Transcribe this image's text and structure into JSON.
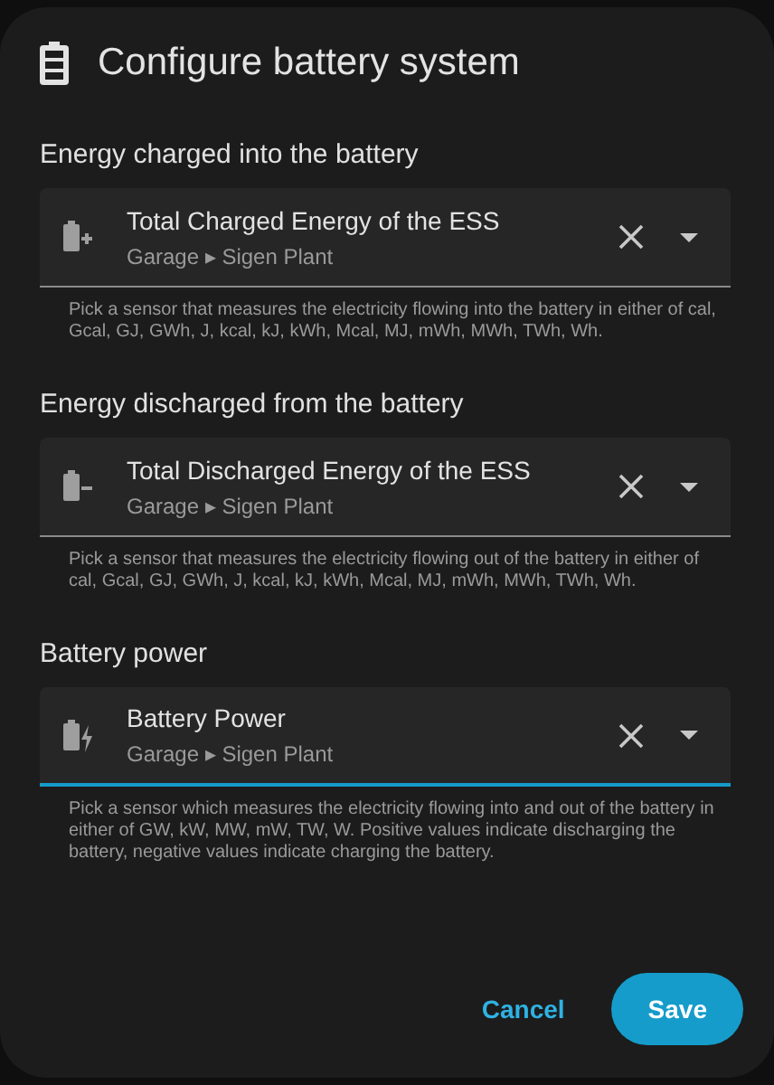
{
  "dialog": {
    "title": "Configure battery system"
  },
  "sections": [
    {
      "label": "Energy charged into the battery",
      "field": {
        "kind": "charging",
        "value": "Total Charged Energy of the ESS",
        "location": "Garage ▸ Sigen Plant",
        "focused": false
      },
      "helper": "Pick a sensor that measures the electricity flowing into the battery in either of cal, Gcal, GJ, GWh, J, kcal, kJ, kWh, Mcal, MJ, mWh, MWh, TWh, Wh."
    },
    {
      "label": "Energy discharged from the battery",
      "field": {
        "kind": "discharging",
        "value": "Total Discharged Energy of the ESS",
        "location": "Garage ▸ Sigen Plant",
        "focused": false
      },
      "helper": "Pick a sensor that measures the electricity flowing out of the battery in either of cal, Gcal, GJ, GWh, J, kcal, kJ, kWh, Mcal, MJ, mWh, MWh, TWh, Wh."
    },
    {
      "label": "Battery power",
      "field": {
        "kind": "power",
        "value": "Battery Power",
        "location": "Garage ▸ Sigen Plant",
        "focused": true
      },
      "helper": "Pick a sensor which measures the electricity flowing into and out of the battery in either of GW, kW, MW, mW, TW, W. Positive values indicate discharging the battery, negative values indicate charging the battery."
    }
  ],
  "buttons": [
    {
      "kind": "text",
      "label": "Cancel"
    },
    {
      "kind": "filled",
      "label": "Save"
    }
  ]
}
